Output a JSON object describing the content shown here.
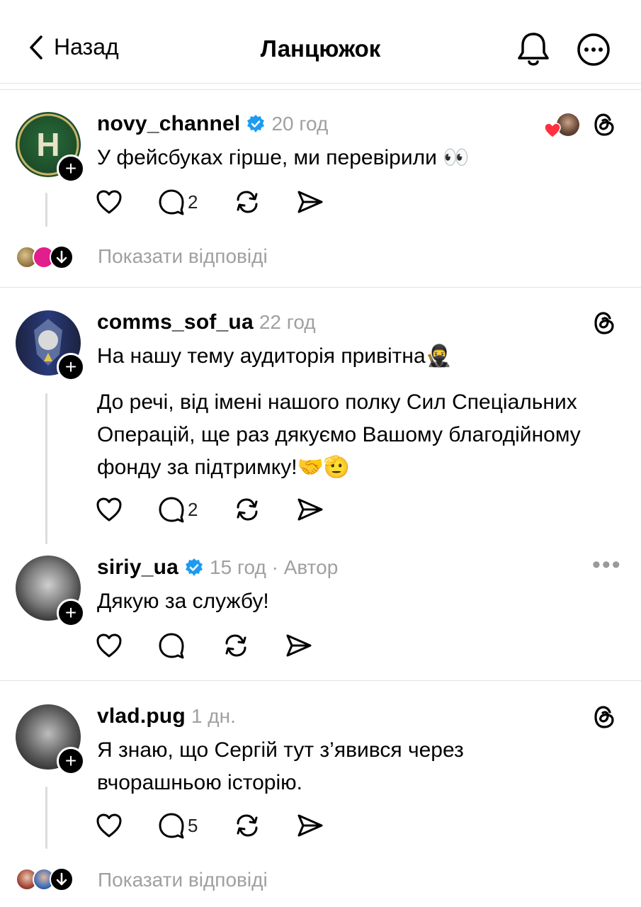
{
  "header": {
    "back_label": "Назад",
    "title": "Ланцюжок"
  },
  "posts": [
    {
      "username": "novy_channel",
      "time": "20 год",
      "verified": true,
      "text": "У фейсбуках гірше, ми перевірили 👀",
      "replies_count": "2",
      "show_replies": "Показати відповіді"
    },
    {
      "username": "comms_sof_ua",
      "time": "22 год",
      "verified": false,
      "text1": "На нашу тему аудиторія привітна🥷",
      "text2": "До речі, від імені нашого полку Сил Спеціальних Операцій, ще раз дякуємо Вашому благодійному фонду за підтримку!🤝🫡",
      "replies_count": "2"
    },
    {
      "username": "siriy_ua",
      "time": "15 год · Автор",
      "verified": true,
      "text": "Дякую за службу!"
    },
    {
      "username": "vlad.pug",
      "time": "1 дн.",
      "verified": false,
      "text": "Я знаю, що Сергій тут з’явився через вчорашньою історію.",
      "replies_count": "5",
      "show_replies": "Показати відповіді"
    }
  ],
  "colors": {
    "verified": "#1d9bf0",
    "muted": "#a0a0a0",
    "heart": "#ff3040"
  }
}
